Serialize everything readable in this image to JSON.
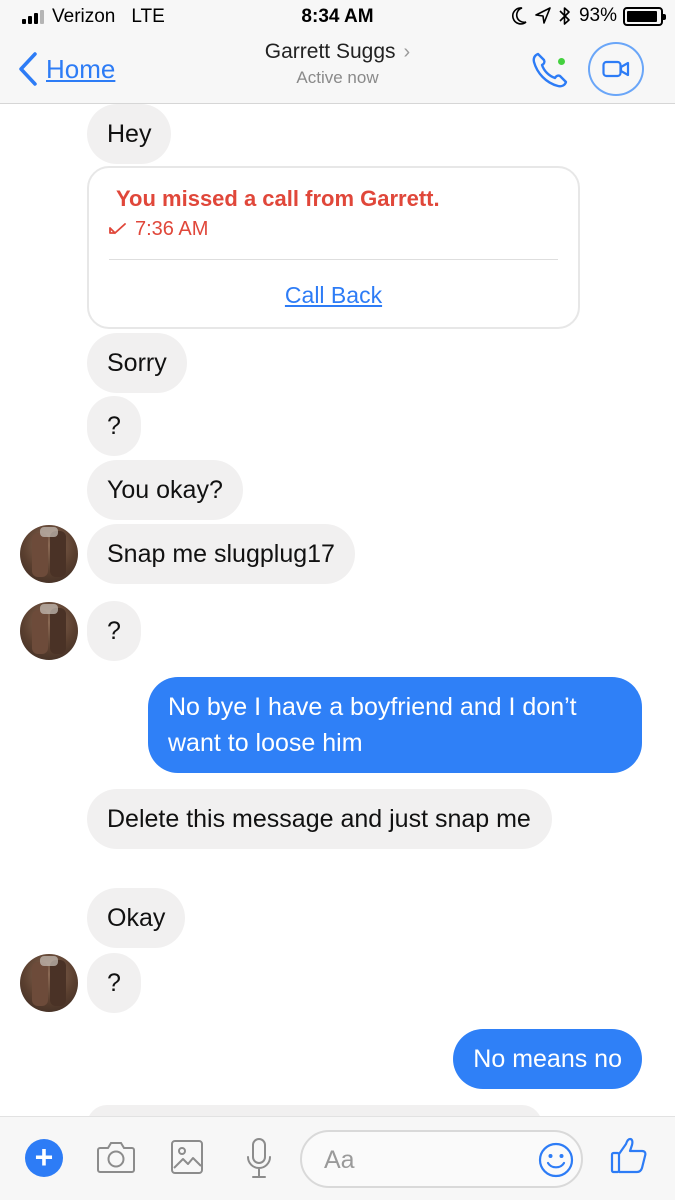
{
  "status_bar": {
    "carrier": "Verizon",
    "network": "LTE",
    "time": "8:34 AM",
    "battery": "93%",
    "battery_level": 0.93
  },
  "nav": {
    "back_label": "Home",
    "contact_name": "Garrett Suggs",
    "status": "Active now"
  },
  "missed_call": {
    "title": "You missed a call from Garrett.",
    "time": "7:36 AM",
    "action": "Call Back"
  },
  "messages": [
    {
      "sender": "them",
      "text": "Hey"
    },
    {
      "sender": "them",
      "text": "Sorry"
    },
    {
      "sender": "them",
      "text": "?"
    },
    {
      "sender": "them",
      "text": "You okay?"
    },
    {
      "sender": "them",
      "text": "Snap me slugplug17"
    },
    {
      "sender": "them",
      "text": "?"
    },
    {
      "sender": "me",
      "text": "No bye I have a boyfriend and I don’t want to loose him"
    },
    {
      "sender": "them",
      "text": "Delete this message and just snap me"
    },
    {
      "sender": "them",
      "text": "Okay"
    },
    {
      "sender": "them",
      "text": "?"
    },
    {
      "sender": "me",
      "text": "No means no"
    }
  ],
  "composer": {
    "placeholder": "Aa",
    "accent_color": "#2d7cf6"
  },
  "colors": {
    "outgoing_bubble": "#2f80f7",
    "incoming_bubble": "#f1f0f0",
    "missed_call": "#e0473a",
    "active_dot": "#44d13f"
  }
}
